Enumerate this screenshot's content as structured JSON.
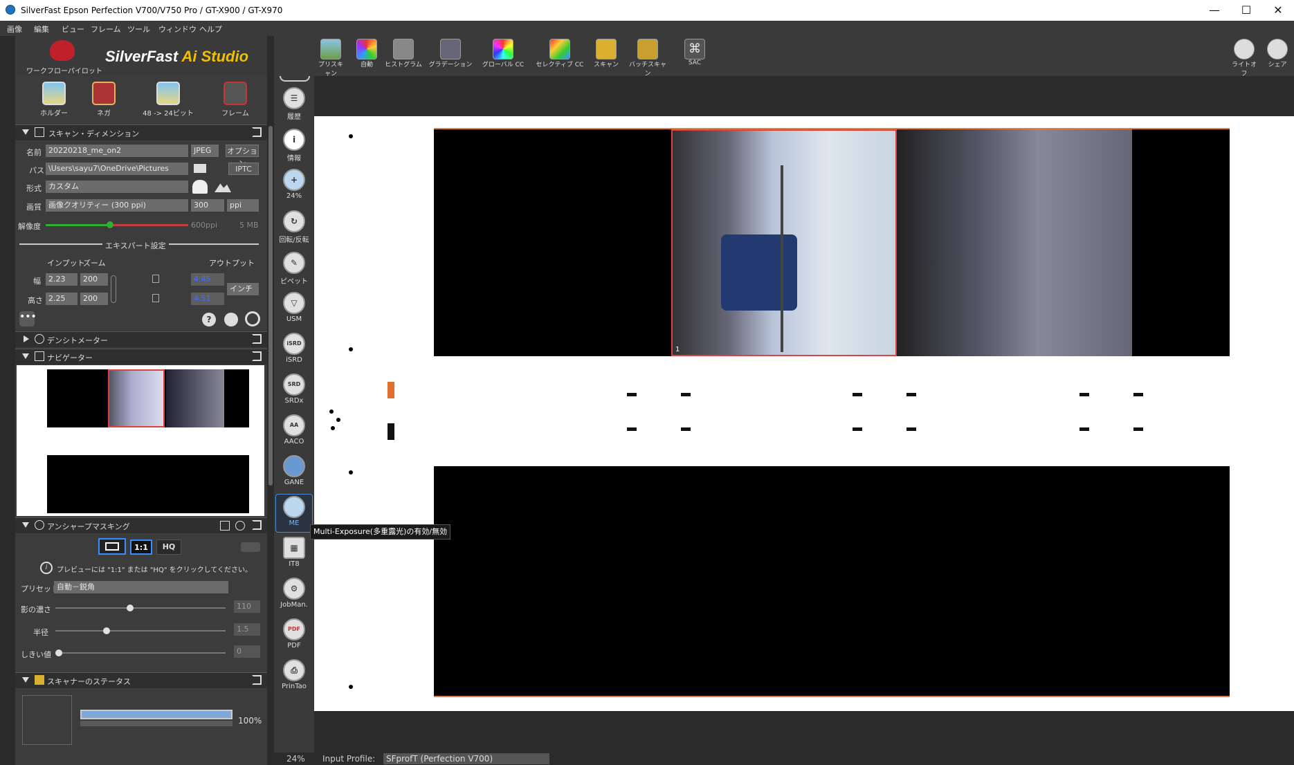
{
  "window": {
    "title": "SilverFast  Epson Perfection V700/V750 Pro / GT-X900 / GT-X970",
    "minimize": "—",
    "maximize": "☐",
    "close": "✕"
  },
  "menu": [
    "画像",
    "編集",
    "ビュー",
    "フレーム",
    "ツール",
    "ウィンドウ",
    "ヘルプ"
  ],
  "brand": {
    "workflow_pilot": "ワークフローパイロット",
    "name": "SilverFast",
    "suffix": "Ai Studio"
  },
  "top_icons": [
    {
      "label": "ホルダー",
      "icon": "holder-icon"
    },
    {
      "label": "ネガ",
      "icon": "negafix-icon"
    },
    {
      "label": "48 -> 24ビット",
      "icon": "bitdepth-icon"
    },
    {
      "label": "フレーム",
      "icon": "frame-tools-icon"
    }
  ],
  "scan_dimension": {
    "header": "スキャン・ディメンション",
    "name_label": "名前",
    "name_value": "20220218_me_on2",
    "format_value": "JPEG",
    "option_label": "オプション",
    "path_label": "パス",
    "path_value": "\\Users\\sayu7\\OneDrive\\Pictures",
    "iptc_label": "IPTC",
    "form_label": "形式",
    "form_value": "カスタム",
    "quality_label": "画質",
    "quality_value": "画像クオリティー (300 ppi)",
    "quality_num": "300",
    "quality_unit": "ppi",
    "resolution_label": "解像度",
    "resolution_ppi": "600ppi",
    "resolution_size": "5 MB",
    "resolution_level": 0.45,
    "expert_label": "エキスパート設定",
    "input_label": "インプット",
    "zoom_label": "ズーム",
    "output_label": "アウトプット",
    "width_label": "幅",
    "height_label": "高さ",
    "width_input": "2.23",
    "height_input": "2.25",
    "width_zoom": "200",
    "height_zoom": "200",
    "width_output": "4.45",
    "height_output": "4.51",
    "unit": "インチ"
  },
  "densitometer": {
    "header": "デンシトメーター"
  },
  "navigator": {
    "header": "ナビゲーター"
  },
  "usm": {
    "header": "アンシャープマスキング",
    "btn_1to1": "1:1",
    "btn_hq": "HQ",
    "info": "プレビューには \"1:1\" または \"HQ\" をクリックしてください。",
    "preset_label": "プリセット",
    "preset_value": "自動－鋭角",
    "shadow_label": "影の濃さ",
    "shadow_value": "110",
    "shadow_level": 0.44,
    "radius_label": "半径",
    "radius_value": "1.5",
    "radius_level": 0.3,
    "threshold_label": "しきい値",
    "threshold_value": "0",
    "threshold_level": 0.0
  },
  "scanner_status": {
    "header": "スキャナーのステータス",
    "progress_text": "100%",
    "progress": 1.0
  },
  "vertical_tools": [
    {
      "label": "履歴",
      "icon": "history-icon"
    },
    {
      "label": "情報",
      "icon": "info-icon"
    },
    {
      "label": "24%",
      "icon": "zoom-icon"
    },
    {
      "label": "回転/反転",
      "icon": "rotate-icon"
    },
    {
      "label": "ピペット",
      "icon": "pipette-icon"
    },
    {
      "label": "USM",
      "icon": "usm-icon"
    },
    {
      "label": "iSRD",
      "icon": "isrd-icon"
    },
    {
      "label": "SRDx",
      "icon": "srdx-icon"
    },
    {
      "label": "AACO",
      "icon": "aaco-icon"
    },
    {
      "label": "GANE",
      "icon": "gane-icon"
    },
    {
      "label": "ME",
      "icon": "me-icon"
    },
    {
      "label": "IT8",
      "icon": "it8-icon"
    },
    {
      "label": "JobMan.",
      "icon": "jobmanager-icon"
    },
    {
      "label": "PDF",
      "icon": "pdf-icon"
    },
    {
      "label": "PrinTao",
      "icon": "printao-icon"
    }
  ],
  "toolbar": [
    {
      "label": "プリスキャン",
      "icon": "prescan-icon"
    },
    {
      "label": "自動",
      "icon": "auto-icon"
    },
    {
      "label": "ヒストグラム",
      "icon": "histogram-icon"
    },
    {
      "label": "グラデーション",
      "icon": "gradation-icon"
    },
    {
      "label": "グローバル CC",
      "icon": "global-cc-icon"
    },
    {
      "label": "セレクティブ CC",
      "icon": "selective-cc-icon"
    },
    {
      "label": "スキャン",
      "icon": "scan-icon"
    },
    {
      "label": "バッチスキャン",
      "icon": "batch-scan-icon"
    },
    {
      "label": "SAC",
      "icon": "sac-icon"
    }
  ],
  "toolbar_right": [
    {
      "label": "ライトオフ",
      "icon": "light-off-icon"
    },
    {
      "label": "シェア",
      "icon": "share-icon"
    }
  ],
  "tooltip": "Multi-Exposure(多重露光)の有効/無効",
  "frame_number": "1",
  "status": {
    "zoom": "24%",
    "input_profile_label": "Input Profile:",
    "input_profile_value": "SFprofT (Perfection V700)"
  }
}
